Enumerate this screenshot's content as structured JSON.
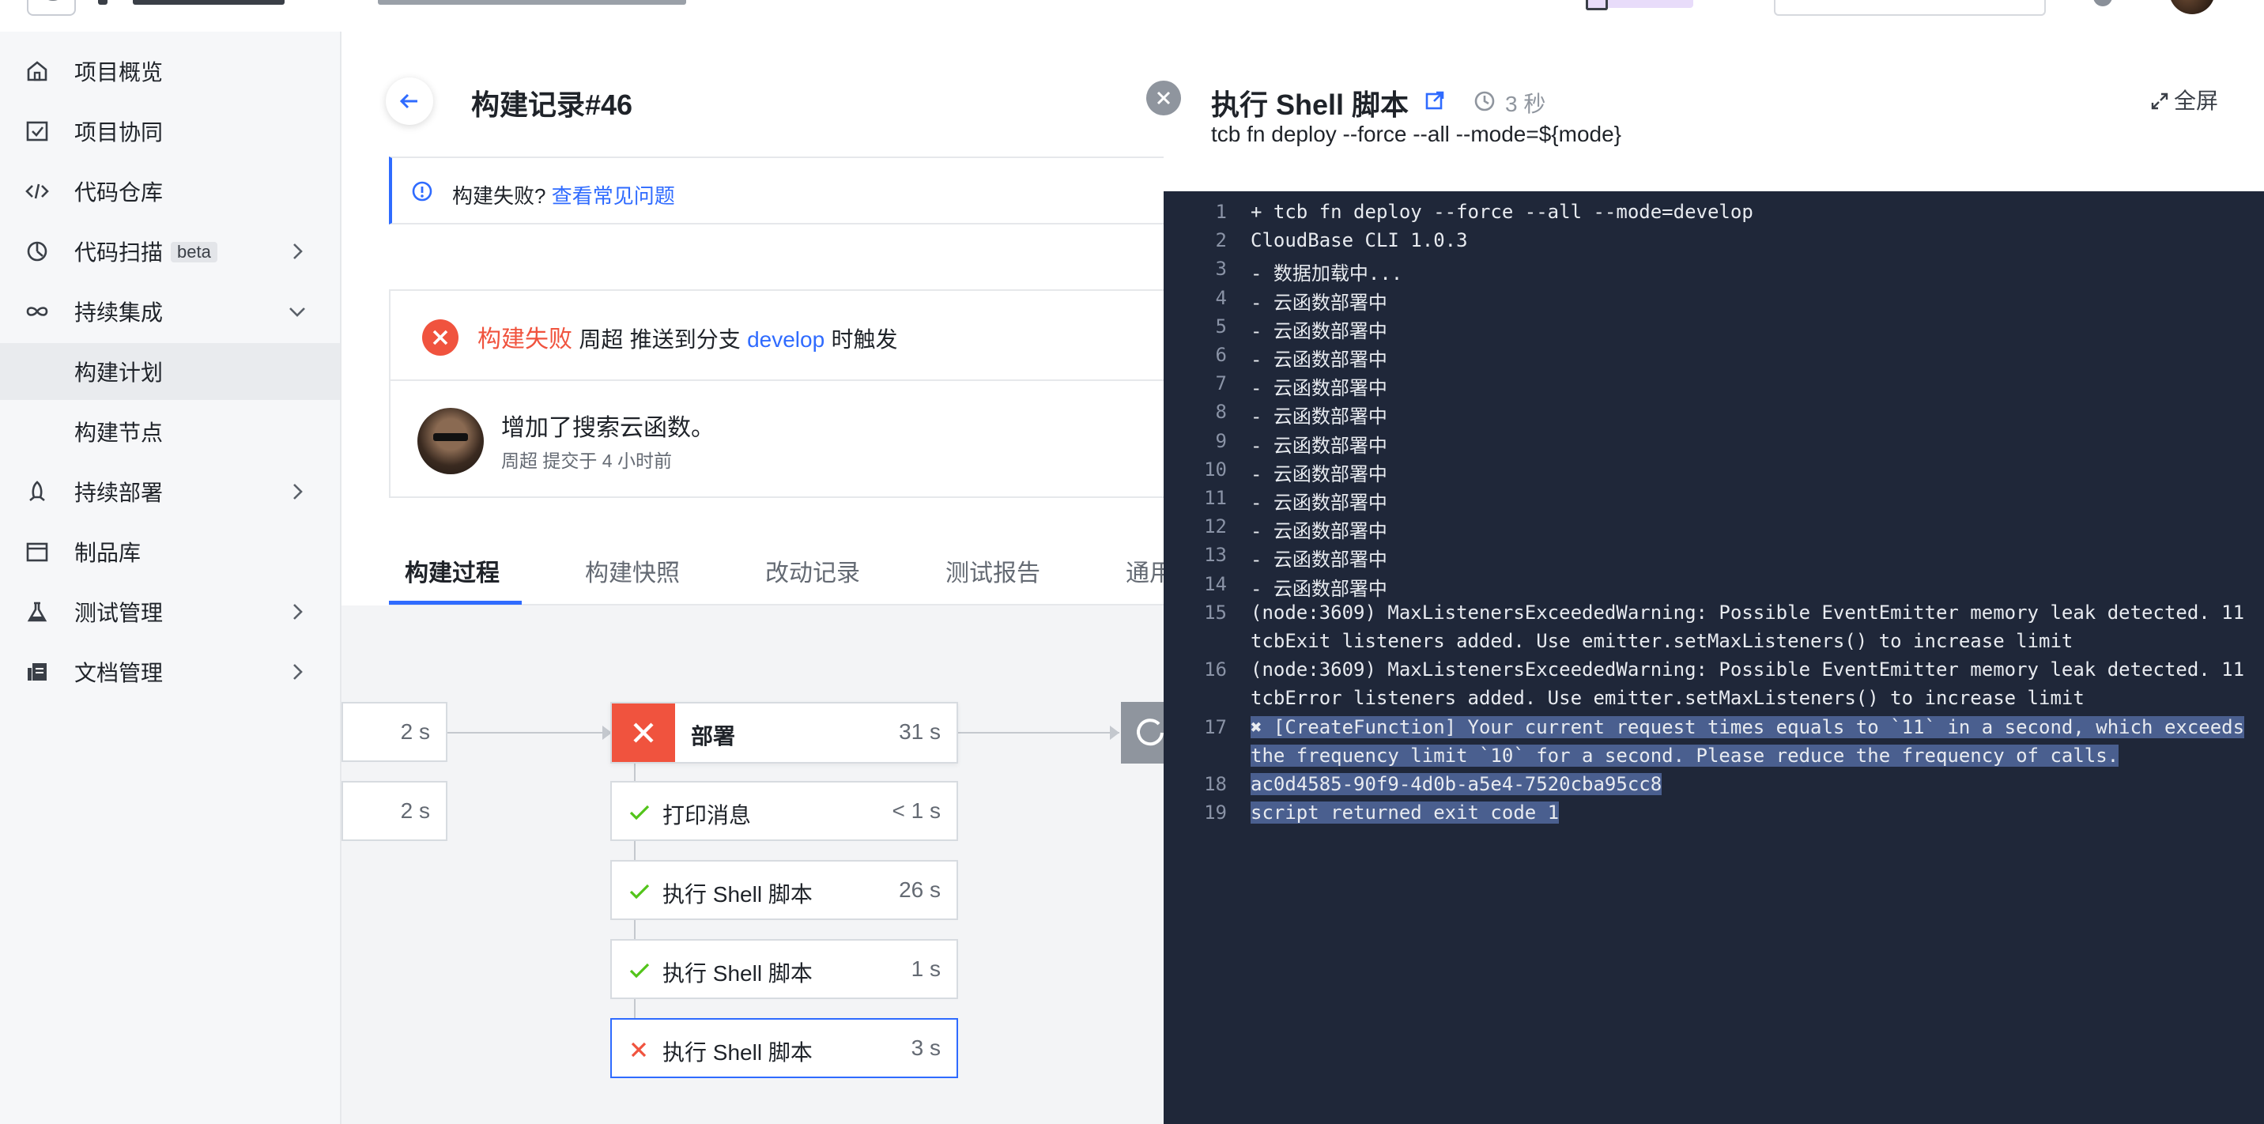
{
  "sidebar": {
    "items": [
      {
        "label": "项目概览",
        "icon": "home-icon"
      },
      {
        "label": "项目协同",
        "icon": "checkbox-icon"
      },
      {
        "label": "代码仓库",
        "icon": "code-icon"
      },
      {
        "label": "代码扫描",
        "icon": "scan-icon",
        "badge": "beta"
      },
      {
        "label": "持续集成",
        "icon": "infinity-icon"
      },
      {
        "label": "构建计划",
        "icon": ""
      },
      {
        "label": "构建节点",
        "icon": ""
      },
      {
        "label": "持续部署",
        "icon": "rocket-icon"
      },
      {
        "label": "制品库",
        "icon": "box-icon"
      },
      {
        "label": "测试管理",
        "icon": "flask-icon"
      },
      {
        "label": "文档管理",
        "icon": "docs-icon"
      }
    ],
    "active_item": "构建计划"
  },
  "page": {
    "title": "构建记录#46"
  },
  "notice": {
    "text": "构建失败?",
    "link": "查看常见问题"
  },
  "build": {
    "status": "构建失败",
    "author": "周超",
    "trigger_text": "推送到分支",
    "branch": "develop",
    "trigger_suffix": "时触发",
    "commit_message": "增加了搜索云函数。",
    "commit_meta": "周超 提交于 4 小时前"
  },
  "tabs": [
    "构建过程",
    "构建快照",
    "改动记录",
    "测试报告",
    "通用"
  ],
  "pipeline": {
    "prev_steps": [
      {
        "duration": "2 s"
      },
      {
        "duration": "2 s"
      }
    ],
    "stage": {
      "name": "部署",
      "duration": "31 s",
      "status": "failed"
    },
    "steps": [
      {
        "name": "打印消息",
        "duration": "< 1 s",
        "status": "success"
      },
      {
        "name": "执行 Shell 脚本",
        "duration": "26 s",
        "status": "success"
      },
      {
        "name": "执行 Shell 脚本",
        "duration": "1 s",
        "status": "success"
      },
      {
        "name": "执行 Shell 脚本",
        "duration": "3 s",
        "status": "failed"
      }
    ]
  },
  "log_panel": {
    "title": "执行 Shell 脚本",
    "duration": "3 秒",
    "fullscreen_label": "全屏",
    "command": "tcb fn deploy --force --all --mode=${mode}",
    "lines": [
      {
        "n": "1",
        "text": "+ tcb fn deploy --force --all --mode=develop"
      },
      {
        "n": "2",
        "text": "CloudBase CLI 1.0.3"
      },
      {
        "n": "3",
        "text": "- 数据加载中..."
      },
      {
        "n": "4",
        "text": "- 云函数部署中"
      },
      {
        "n": "5",
        "text": "- 云函数部署中"
      },
      {
        "n": "6",
        "text": "- 云函数部署中"
      },
      {
        "n": "7",
        "text": "- 云函数部署中"
      },
      {
        "n": "8",
        "text": "- 云函数部署中"
      },
      {
        "n": "9",
        "text": "- 云函数部署中"
      },
      {
        "n": "10",
        "text": "- 云函数部署中"
      },
      {
        "n": "11",
        "text": "- 云函数部署中"
      },
      {
        "n": "12",
        "text": "- 云函数部署中"
      },
      {
        "n": "13",
        "text": "- 云函数部署中"
      },
      {
        "n": "14",
        "text": "- 云函数部署中"
      },
      {
        "n": "15",
        "text": "(node:3609) MaxListenersExceededWarning: Possible EventEmitter memory leak detected. 11",
        "cont": "tcbExit listeners added. Use emitter.setMaxListeners() to increase limit"
      },
      {
        "n": "16",
        "text": "(node:3609) MaxListenersExceededWarning: Possible EventEmitter memory leak detected. 11",
        "cont": "tcbError listeners added. Use emitter.setMaxListeners() to increase limit"
      },
      {
        "n": "17",
        "text": "✖ [CreateFunction] Your current request times equals to `11` in a second, which exceeds",
        "cont": "the frequency limit `10` for a second. Please reduce the frequency of calls.",
        "selected": true
      },
      {
        "n": "18",
        "text": "ac0d4585-90f9-4d0b-a5e4-7520cba95cc8",
        "selected": true
      },
      {
        "n": "19",
        "text": "script returned exit code 1",
        "selected": true
      }
    ]
  },
  "colors": {
    "accent": "#2f6bff",
    "error": "#f0533e",
    "success": "#52c41a",
    "log_bg": "#1f2739"
  }
}
